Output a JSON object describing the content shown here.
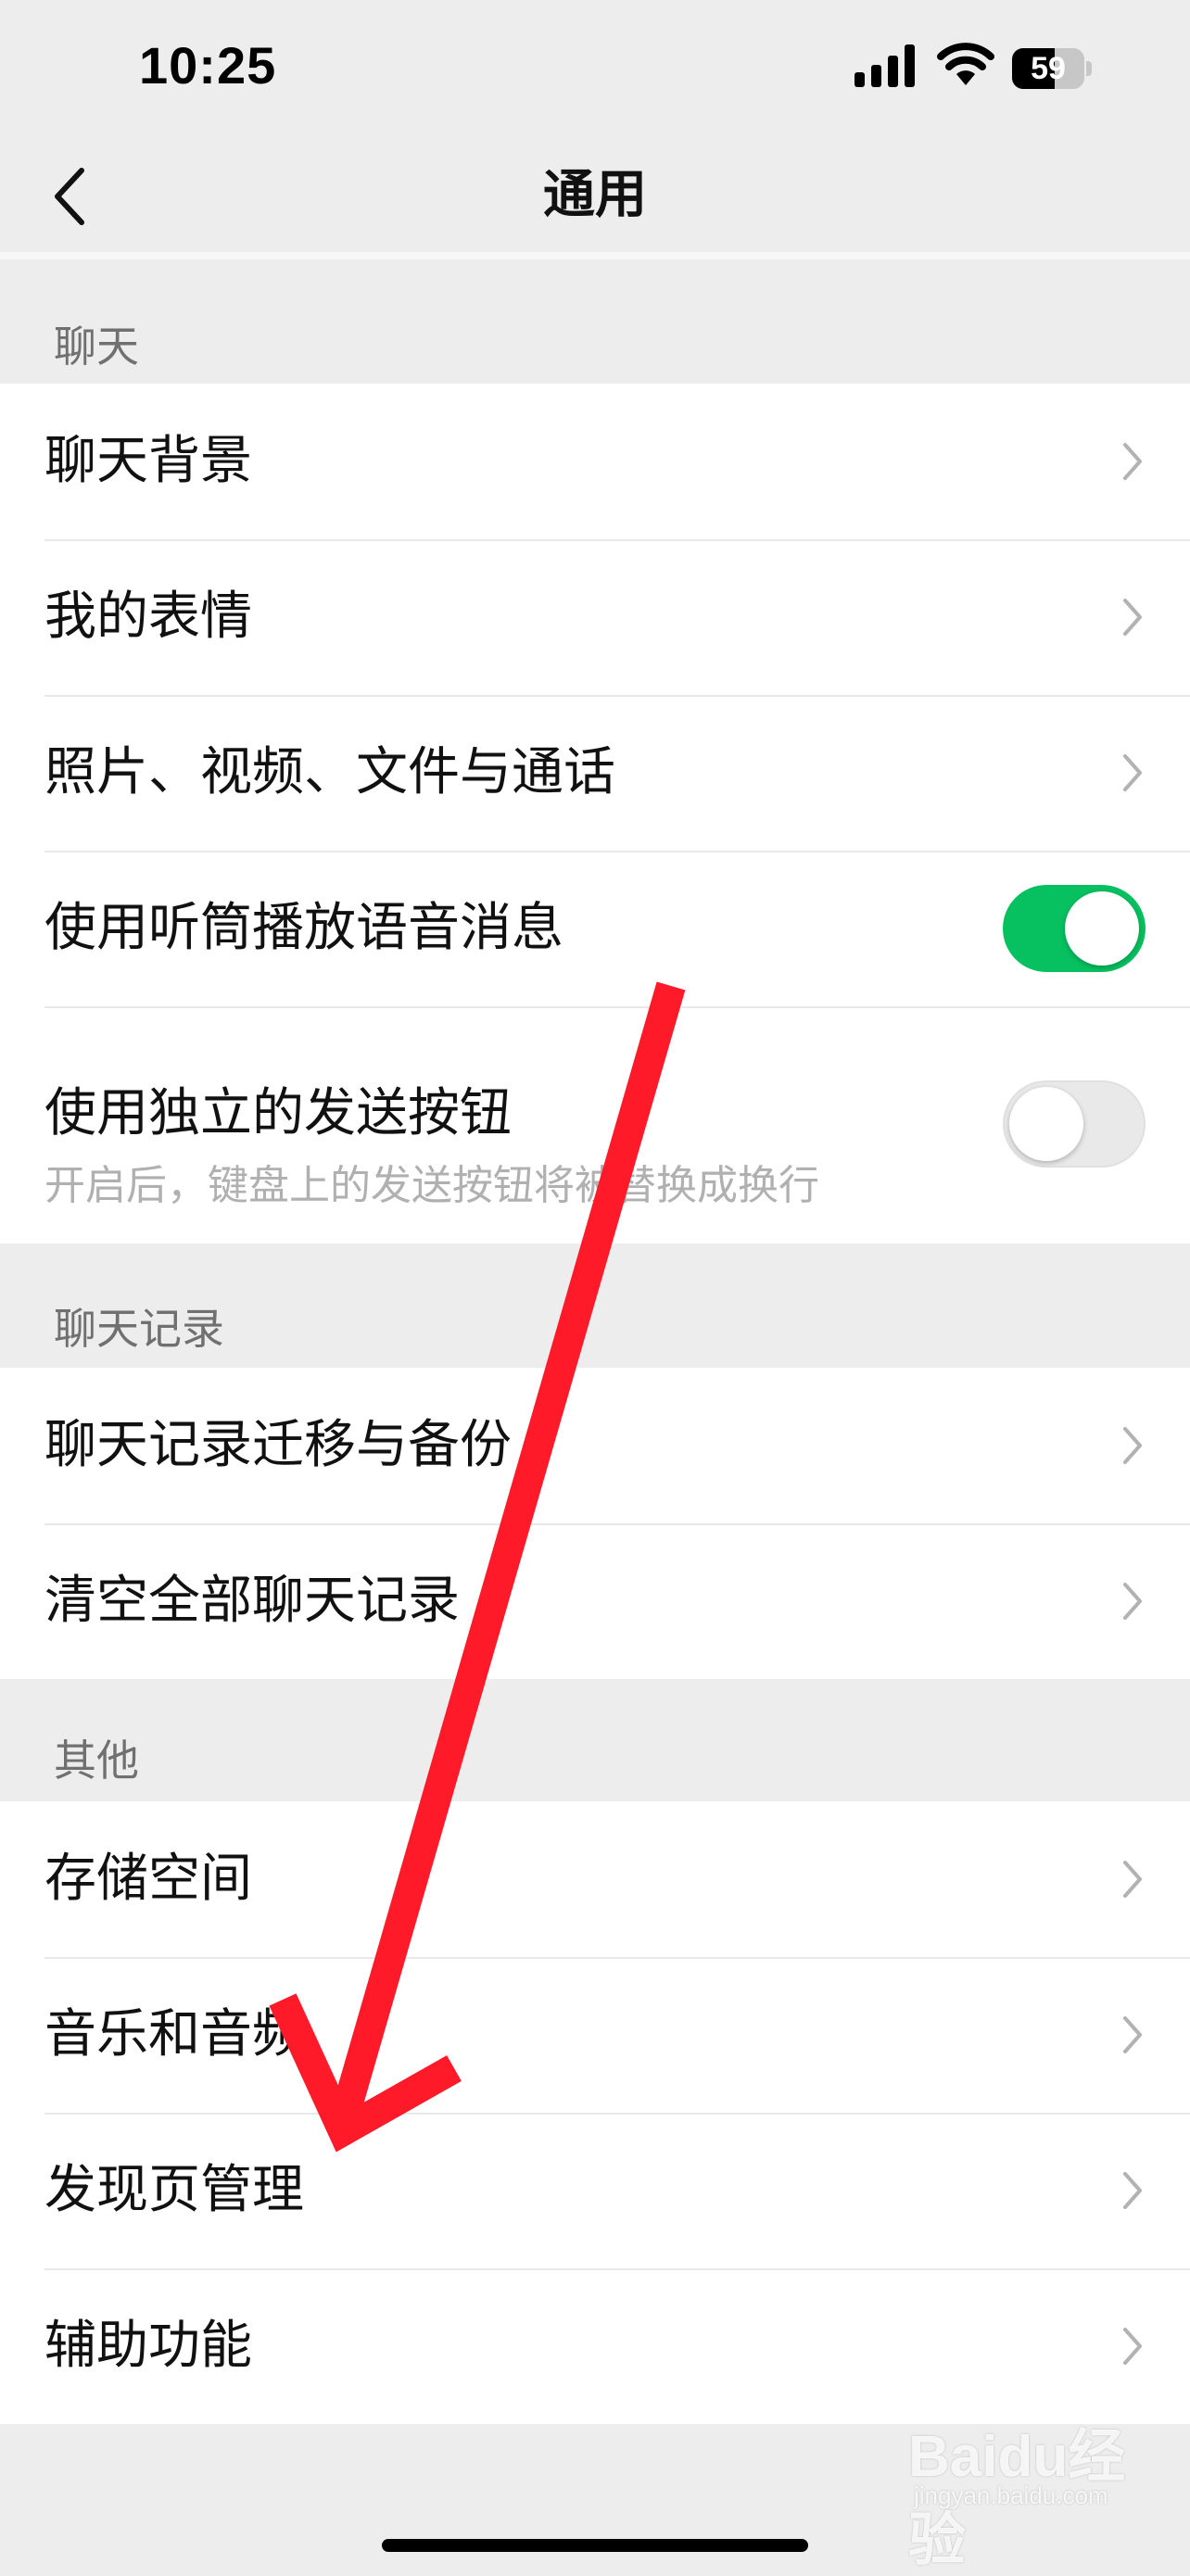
{
  "status_bar": {
    "time": "10:25",
    "battery_level": "59",
    "battery_fraction": 0.59,
    "icons": [
      "signal-icon",
      "wifi-icon",
      "battery-icon"
    ]
  },
  "nav": {
    "title": "通用",
    "back_icon": "chevron-left-icon"
  },
  "sections": {
    "chat": {
      "header": "聊天",
      "items": [
        {
          "label": "聊天背景"
        },
        {
          "label": "我的表情"
        },
        {
          "label": "照片、视频、文件与通话"
        },
        {
          "label": "使用听筒播放语音消息",
          "toggle": true
        },
        {
          "label": "使用独立的发送按钮",
          "subtitle": "开启后，键盘上的发送按钮将被替换成换行",
          "toggle": false
        }
      ]
    },
    "history": {
      "header": "聊天记录",
      "items": [
        {
          "label": "聊天记录迁移与备份"
        },
        {
          "label": "清空全部聊天记录"
        }
      ]
    },
    "other": {
      "header": "其他",
      "items": [
        {
          "label": "存储空间"
        },
        {
          "label": "音乐和音频"
        },
        {
          "label": "发现页管理"
        },
        {
          "label": "辅助功能"
        }
      ]
    }
  },
  "colors": {
    "toggle_on": "#07c160",
    "annotation_arrow": "#ff1a2a",
    "background": "#ededed"
  },
  "watermark": {
    "text": "Baidu经验",
    "sub": "jingyan.baidu.com"
  }
}
